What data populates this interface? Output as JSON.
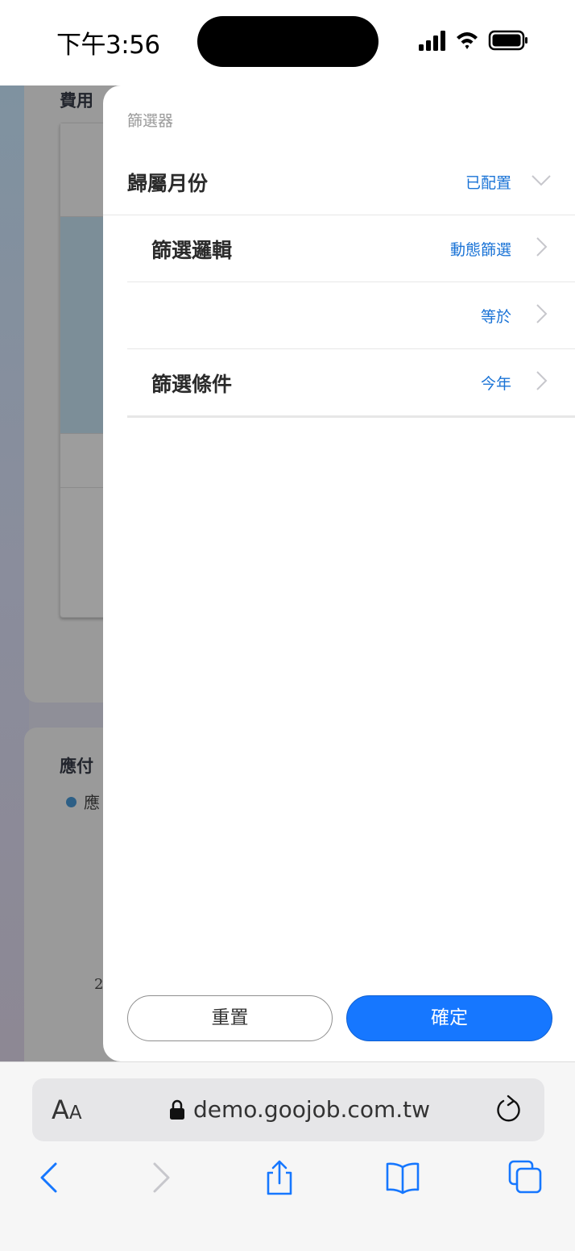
{
  "status_bar": {
    "time": "下午3:56"
  },
  "background_page": {
    "card1_title": "費用",
    "card2_title": "應付",
    "legend_label": "應",
    "axis_tick": "2"
  },
  "filter_panel": {
    "title": "篩選器",
    "rows": [
      {
        "label": "歸屬月份",
        "value": "已配置",
        "chevron": "chevron-down"
      },
      {
        "label": "篩選邏輯",
        "value": "動態篩選",
        "chevron": "chevron-right"
      },
      {
        "label": "",
        "value": "等於",
        "chevron": "chevron-right"
      },
      {
        "label": "篩選條件",
        "value": "今年",
        "chevron": "chevron-right"
      }
    ],
    "reset_label": "重置",
    "confirm_label": "確定"
  },
  "browser": {
    "text_size_label_big": "A",
    "text_size_label_small": "A",
    "url": "demo.goojob.com.tw",
    "toolbar_icons": [
      "back-icon",
      "forward-icon",
      "share-icon",
      "bookmarks-icon",
      "tabs-icon"
    ]
  },
  "colors": {
    "accent": "#1677ff",
    "value_text": "#1a73d6",
    "overlay": "#8f8f98"
  }
}
